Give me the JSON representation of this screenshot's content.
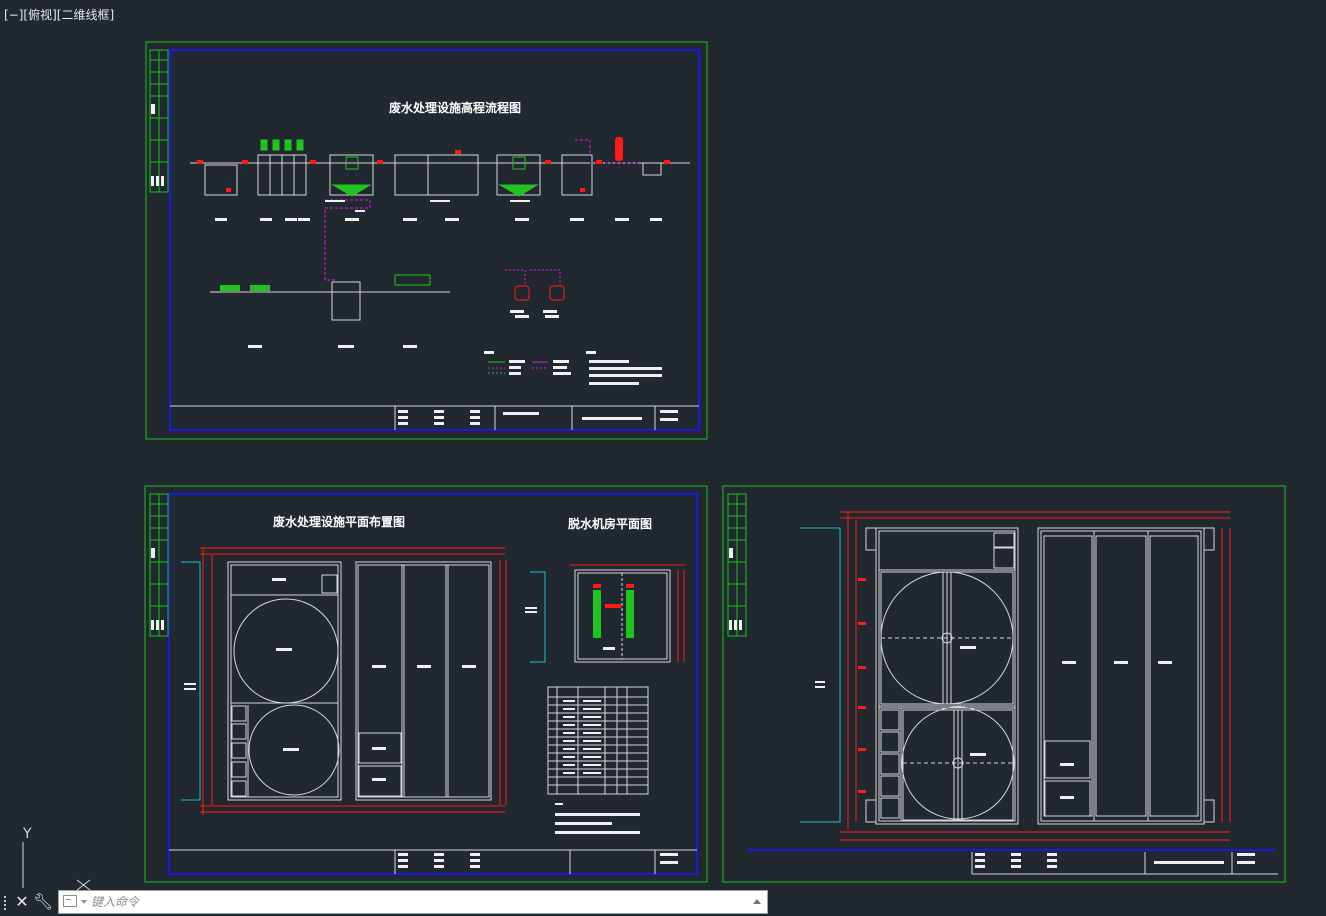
{
  "viewport": {
    "label": "[−][俯视][二维线框]"
  },
  "sheets": {
    "flow": {
      "title": "废水处理设施高程流程图"
    },
    "plan": {
      "title": "废水处理设施平面布置图",
      "subtitle": "脱水机房平面图"
    }
  },
  "ucs": {
    "y_label": "Y"
  },
  "command_line": {
    "placeholder": "键入命令"
  },
  "icons": {
    "close": "close-icon",
    "customize": "wrench-icon",
    "prompt": "command-prompt-icon",
    "history": "chevron-up-icon"
  },
  "colors": {
    "background": "#212830",
    "border_green": "#19c319",
    "border_blue": "#1919e6",
    "line_white": "#d8d8d8",
    "line_red": "#ff1a1a",
    "line_magenta": "#d91ad9",
    "line_cyan": "#19c3c3",
    "equip_green": "#21c321"
  }
}
